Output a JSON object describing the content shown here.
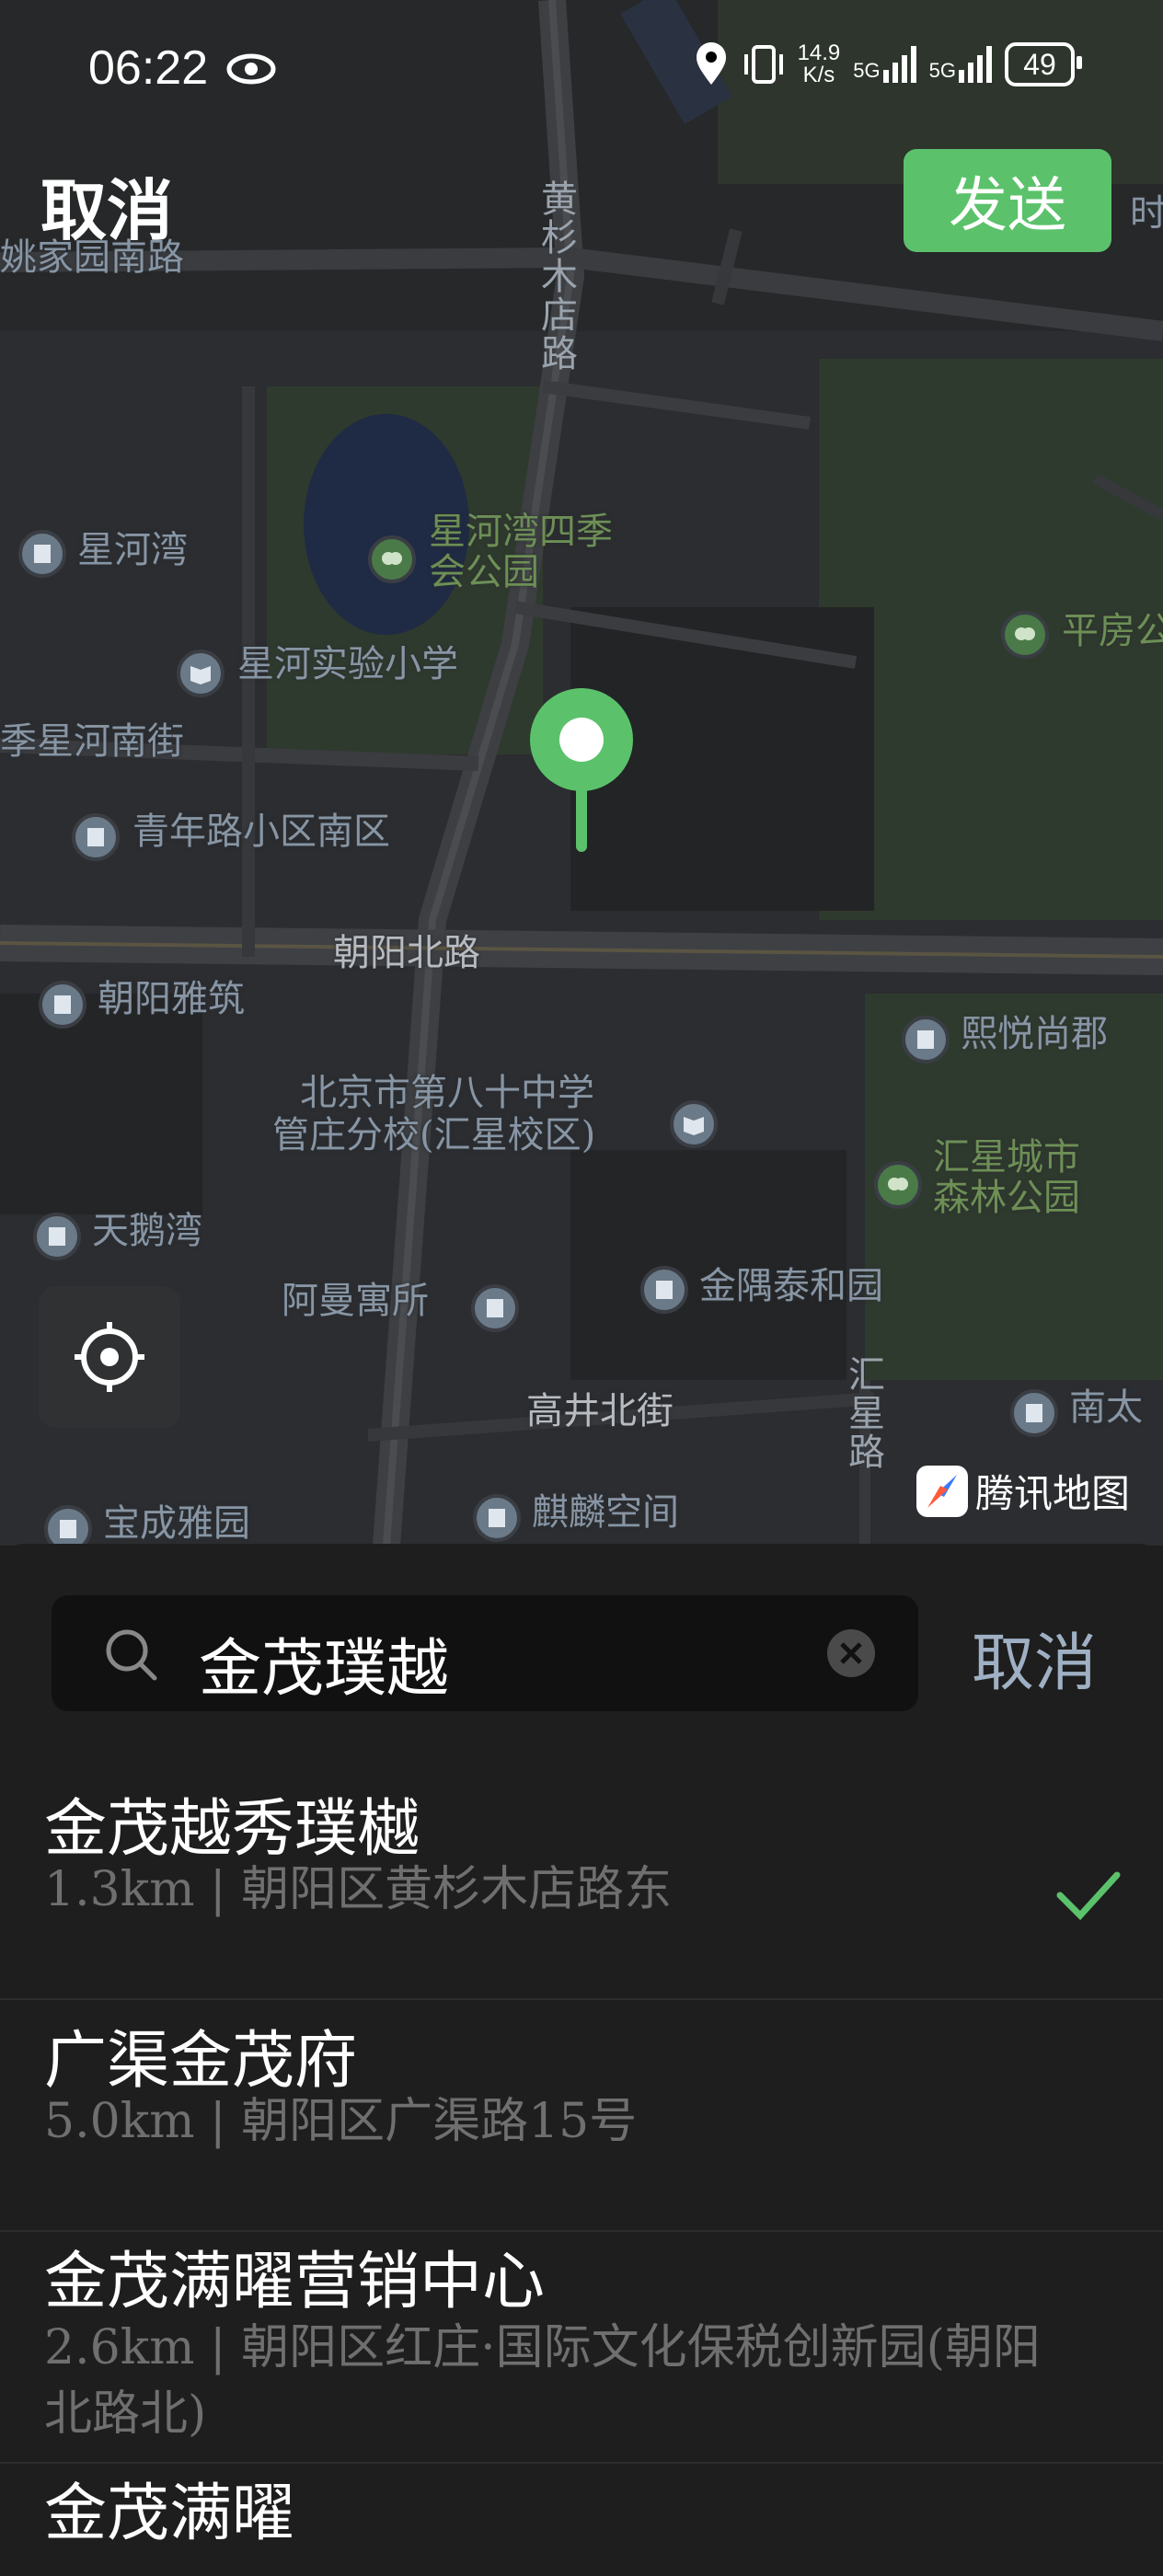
{
  "status_bar": {
    "time": "06:22",
    "speed_value": "14.9",
    "speed_unit": "K/s",
    "net1": "5G",
    "net2": "5G",
    "battery": "49"
  },
  "header": {
    "cancel_label": "取消",
    "send_label": "发送"
  },
  "map": {
    "labels": {
      "yao": "姚家园南路",
      "huangshanmu_v": "黄杉木店路",
      "xinghewan": "星河湾",
      "park1a": "星河湾四季",
      "park1b": "会公园",
      "pingfang": "平房公",
      "school1": "星河实验小学",
      "xingheNanjie": "季星河南街",
      "qingnian": "青年路小区南区",
      "chaoyangNorth": "朝阳北路",
      "chaoyangYazhu": "朝阳雅筑",
      "xiyue": "熙悦尚郡",
      "school2a": "北京市第八十中学",
      "school2b": "管庄分校(汇星校区)",
      "park2a": "汇星城市",
      "park2b": "森林公园",
      "tiane": "天鹅湾",
      "aman": "阿曼寓所",
      "jinyu": "金隅泰和园",
      "huixing_v": "汇星路",
      "gaojing": "高井北街",
      "nantai": "南太",
      "baocheng": "宝成雅园",
      "qilin": "麒麟空间",
      "shi": "时"
    },
    "brand": "腾讯地图",
    "accent": "#5bc26b"
  },
  "search": {
    "value": "金茂璞越",
    "cancel_label": "取消"
  },
  "results": [
    {
      "name": "金茂越秀璞樾",
      "desc": "1.3km | 朝阳区黄杉木店路东",
      "selected": true
    },
    {
      "name": "广渠金茂府",
      "desc": "5.0km | 朝阳区广渠路15号",
      "selected": false
    },
    {
      "name": "金茂满曜营销中心",
      "desc": "2.6km | 朝阳区红庄·国际文化保税创新园(朝阳北路北)",
      "selected": false
    },
    {
      "name": "金茂满曜",
      "desc": "",
      "selected": false
    }
  ]
}
